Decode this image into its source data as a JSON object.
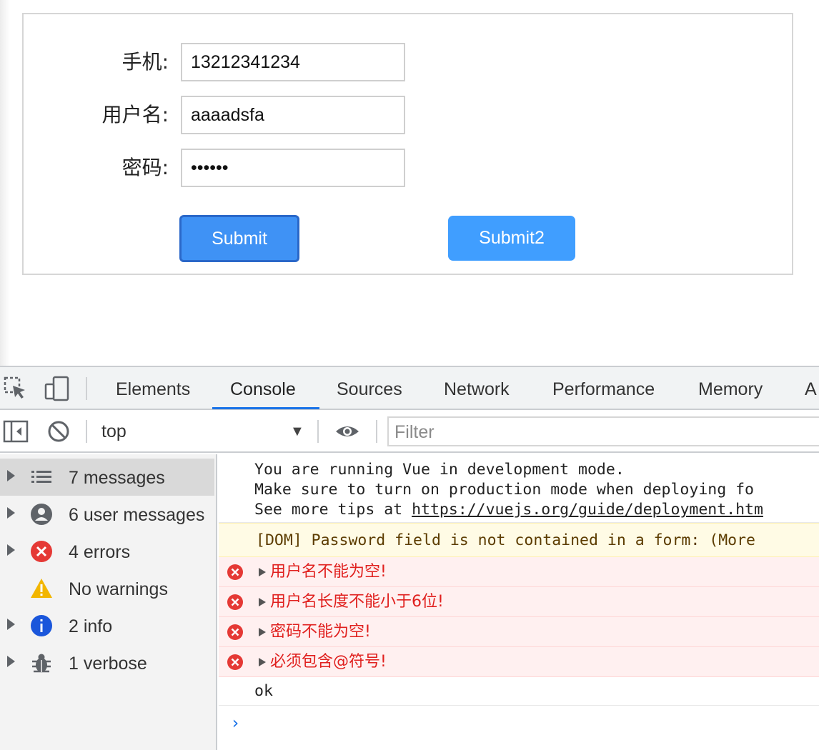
{
  "form": {
    "phone_label": "手机:",
    "phone_value": "13212341234",
    "username_label": "用户名:",
    "username_value": "aaaadsfa",
    "password_label": "密码:",
    "password_value": "••••••",
    "submit_label": "Submit",
    "submit2_label": "Submit2"
  },
  "devtools": {
    "tabs": [
      "Elements",
      "Console",
      "Sources",
      "Network",
      "Performance",
      "Memory",
      "A"
    ],
    "active_tab": "Console",
    "context": "top",
    "filter_placeholder": "Filter",
    "sidebar": [
      {
        "label": "7 messages",
        "icon": "list-icon"
      },
      {
        "label": "6 user messages",
        "icon": "user-icon"
      },
      {
        "label": "4 errors",
        "icon": "error-icon"
      },
      {
        "label": "No warnings",
        "icon": "warning-icon"
      },
      {
        "label": "2 info",
        "icon": "info-icon"
      },
      {
        "label": "1 verbose",
        "icon": "bug-icon"
      }
    ],
    "console": {
      "vue_line1": "You are running Vue in development mode.",
      "vue_line2": "Make sure to turn on production mode when deploying fo",
      "vue_line3_prefix": "See more tips at ",
      "vue_line3_link": "https://vuejs.org/guide/deployment.htm",
      "warning": "[DOM] Password field is not contained in a form: (More",
      "errors": [
        "用户名不能为空!",
        "用户名长度不能小于6位!",
        "密码不能为空!",
        "必须包含@符号!"
      ],
      "ok": "ok",
      "prompt": "›"
    },
    "colors": {
      "accent": "#1a73e8",
      "error": "#e0201e",
      "button": "#409eff"
    }
  }
}
